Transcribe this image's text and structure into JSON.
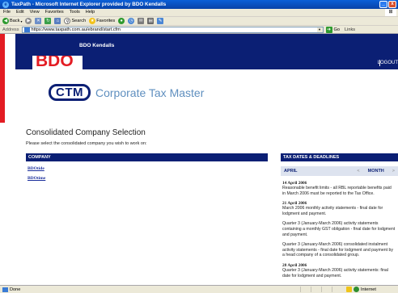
{
  "browser": {
    "title": "TaxPath - Microsoft Internet Explorer provided by BDO Kendalls",
    "menu": [
      "File",
      "Edit",
      "View",
      "Favorites",
      "Tools",
      "Help"
    ],
    "toolbar": {
      "back": "Back",
      "search": "Search",
      "favorites": "Favorites"
    },
    "address_label": "Address",
    "url": "https://www.taxpath.com.au/ebrand/start.cfm",
    "go": "Go",
    "links": "Links",
    "status": "Done",
    "zone": "Internet"
  },
  "header": {
    "logo_text": "BDO",
    "brand": "BDO Kendalls",
    "logout": "LOGOUT"
  },
  "ctm": {
    "badge": "CTM",
    "title": "Corporate Tax Master"
  },
  "main": {
    "title": "Consolidated Company Selection",
    "instruction": "Please select the consolidated company you wish to work on:",
    "company_header": "COMPANY",
    "companies": [
      "BDOtide",
      "BDOtime"
    ]
  },
  "tax": {
    "header": "TAX DATES & DEADLINES",
    "month": "APRIL",
    "prev": "<",
    "next_label": "MONTH",
    "next": ">",
    "deadlines": [
      {
        "date": "14 April 2006",
        "text": "Reasonable benefit limits - all RBL reportable benefits paid in March 2006 must be reported to the Tax Office."
      },
      {
        "date": "21 April 2006",
        "text": "March 2006 monthly activity statements - final date for lodgment and payment."
      },
      {
        "date": "",
        "text": "Quarter 3 (January-March 2006) activity statements containing a monthly GST obligation - final date for lodgment and payment."
      },
      {
        "date": "",
        "text": "Quarter 3 (January-March 2006) consolidated instalment activity statements - final date for lodgment and payment by a head company of a consolidated group."
      },
      {
        "date": "28 April 2006",
        "text": "Quarter 3 (January-March 2006) activity statements: final date for lodgment and payment."
      }
    ]
  },
  "colors": {
    "navy": "#0b1f74",
    "bdo_red": "#e31c23",
    "ctm_blue": "#5f8fbf"
  }
}
